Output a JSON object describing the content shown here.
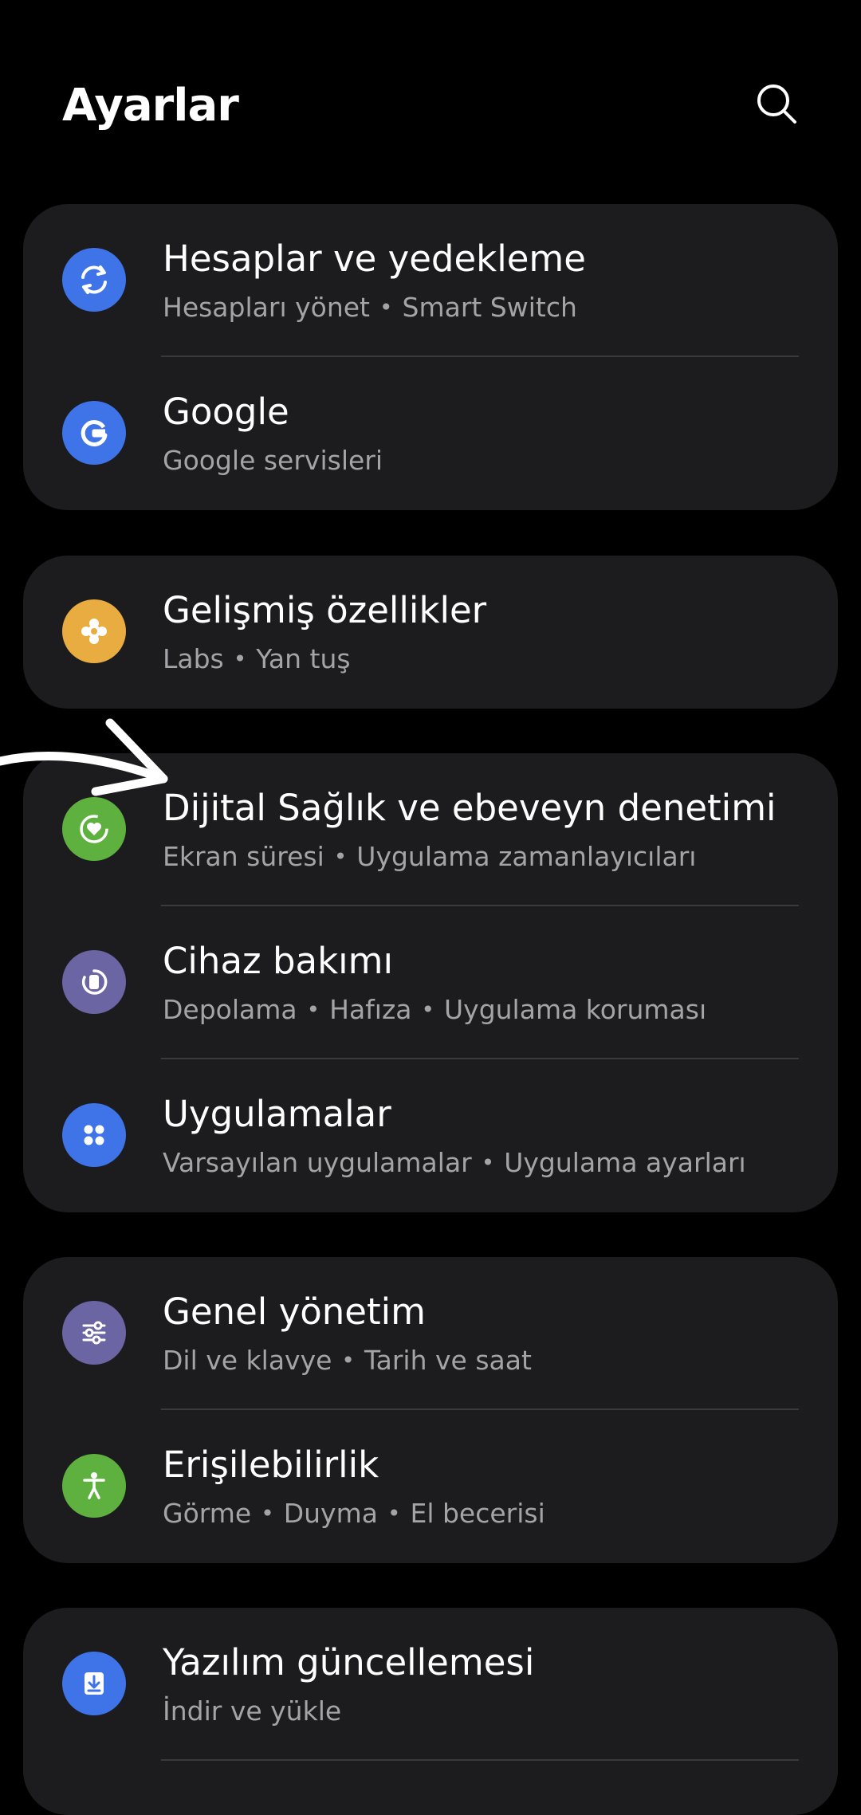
{
  "header": {
    "title": "Ayarlar",
    "search_icon": "search-icon"
  },
  "colors": {
    "accounts": "#3e74e8",
    "google": "#3e74e8",
    "advanced": "#e9ac41",
    "digital": "#5eb13f",
    "device": "#6b65a3",
    "apps": "#3e74e8",
    "general": "#6b65a3",
    "accessibility": "#5eb13f",
    "software": "#3e74e8"
  },
  "groups": [
    {
      "items": [
        {
          "title": "Hesaplar ve yedekleme",
          "subs": [
            "Hesapları yönet",
            "Smart Switch"
          ],
          "icon": "sync-icon"
        },
        {
          "title": "Google",
          "subs": [
            "Google servisleri"
          ],
          "icon": "google-icon"
        }
      ]
    },
    {
      "items": [
        {
          "title": "Gelişmiş özellikler",
          "subs": [
            "Labs",
            "Yan tuş"
          ],
          "icon": "puzzle-gear-icon"
        }
      ]
    },
    {
      "items": [
        {
          "title": "Dijital Sağlık ve ebeveyn denetimi",
          "subs": [
            "Ekran süresi",
            "Uygulama zamanlayıcıları"
          ],
          "icon": "heart-ring-icon"
        },
        {
          "title": "Cihaz bakımı",
          "subs": [
            "Depolama",
            "Hafıza",
            "Uygulama koruması"
          ],
          "icon": "device-care-icon"
        },
        {
          "title": "Uygulamalar",
          "subs": [
            "Varsayılan uygulamalar",
            "Uygulama ayarları"
          ],
          "icon": "apps-grid-icon"
        }
      ]
    },
    {
      "items": [
        {
          "title": "Genel yönetim",
          "subs": [
            "Dil ve klavye",
            "Tarih ve saat"
          ],
          "icon": "sliders-icon"
        },
        {
          "title": "Erişilebilirlik",
          "subs": [
            "Görme",
            "Duyma",
            "El becerisi"
          ],
          "icon": "accessibility-icon"
        }
      ]
    },
    {
      "items": [
        {
          "title": "Yazılım güncellemesi",
          "subs": [
            "İndir ve yükle"
          ],
          "icon": "download-icon"
        }
      ]
    }
  ]
}
